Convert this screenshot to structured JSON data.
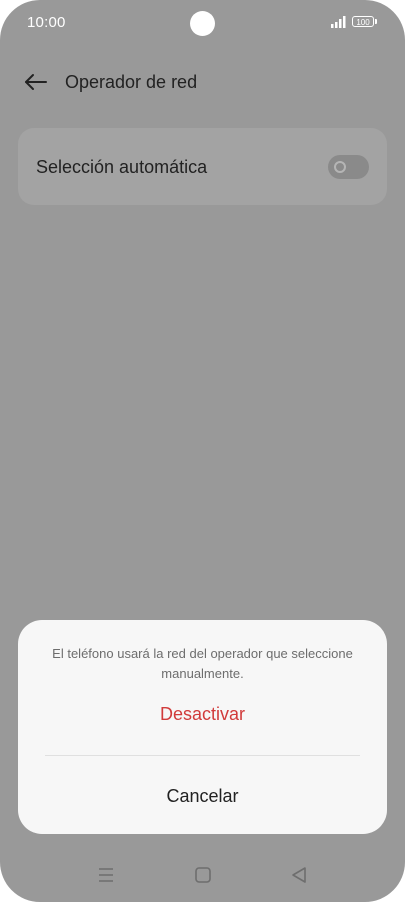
{
  "status_bar": {
    "time": "10:00",
    "battery": "100",
    "icons": [
      "camera-cutout",
      "signal-icon",
      "battery-icon"
    ]
  },
  "header": {
    "title": "Operador de red",
    "back_icon": "arrow-left-icon"
  },
  "settings": {
    "automatic_selection": {
      "label": "Selección automática",
      "toggle_on": false
    }
  },
  "dialog": {
    "message": "El teléfono usará la red del operador que seleccione manualmente.",
    "confirm_label": "Desactivar",
    "cancel_label": "Cancelar",
    "confirm_color": "#d13b3b"
  },
  "nav_bar": {
    "icons": [
      "menu-icon",
      "home-icon",
      "back-icon"
    ]
  },
  "colors": {
    "scrim": "#999999",
    "sheet_background": "#f7f7f7",
    "text_primary": "#222222"
  }
}
